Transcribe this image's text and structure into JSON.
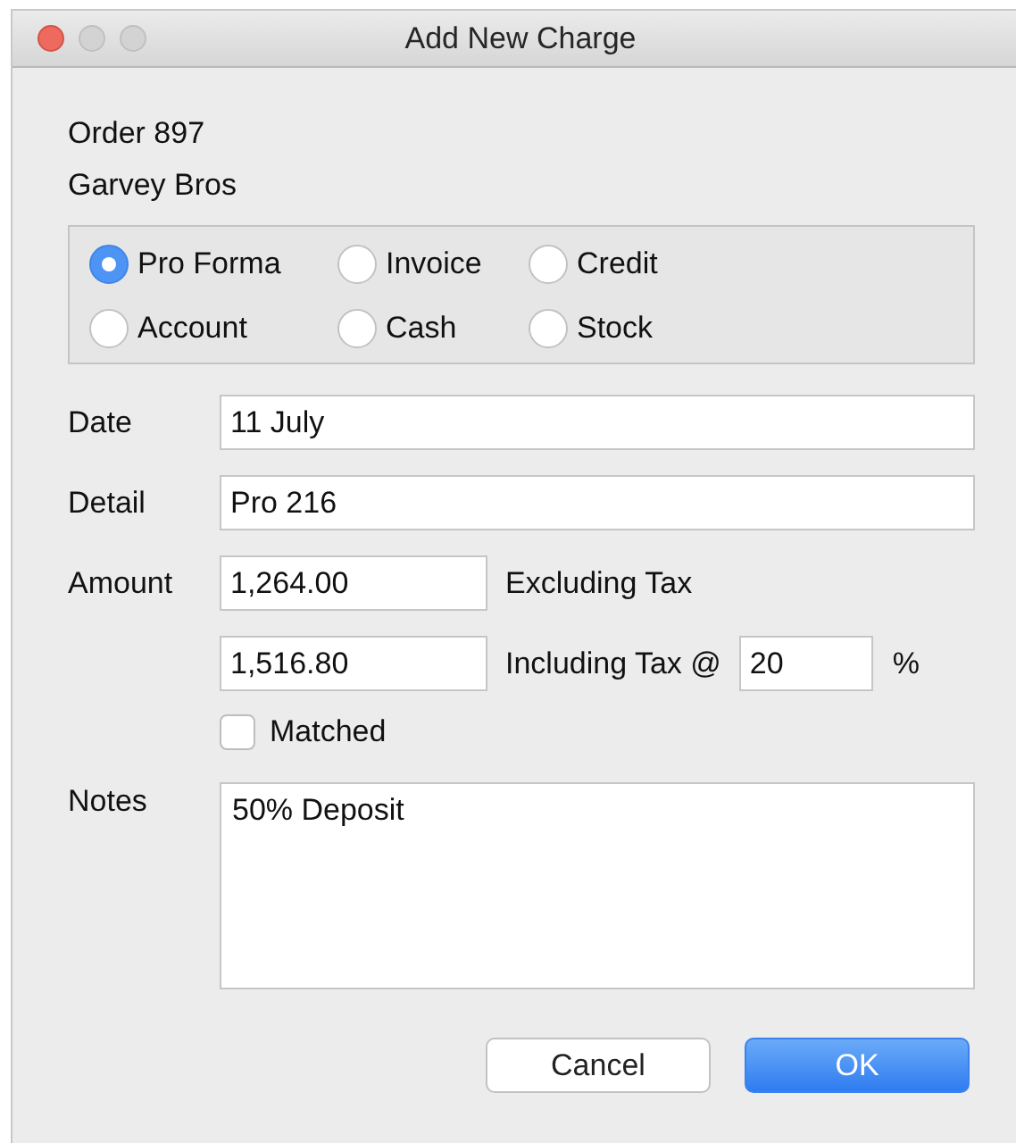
{
  "window": {
    "title": "Add New Charge"
  },
  "header": {
    "order": "Order 897",
    "customer": "Garvey Bros"
  },
  "charge_types": [
    {
      "label": "Pro Forma",
      "selected": true
    },
    {
      "label": "Invoice",
      "selected": false
    },
    {
      "label": "Credit",
      "selected": false
    },
    {
      "label": "Account",
      "selected": false
    },
    {
      "label": "Cash",
      "selected": false
    },
    {
      "label": "Stock",
      "selected": false
    }
  ],
  "date": {
    "label": "Date",
    "value": "11 July"
  },
  "detail": {
    "label": "Detail",
    "value": "Pro 216"
  },
  "amount": {
    "label": "Amount",
    "excluding_value": "1,264.00",
    "excluding_label": "Excluding Tax",
    "including_value": "1,516.80",
    "including_label": "Including Tax @",
    "tax_rate": "20",
    "percent": "%"
  },
  "matched": {
    "label": "Matched",
    "checked": false
  },
  "notes": {
    "label": "Notes",
    "value": "50% Deposit"
  },
  "buttons": [
    {
      "label": "Cancel",
      "kind": "secondary"
    },
    {
      "label": "OK",
      "kind": "primary"
    }
  ]
}
